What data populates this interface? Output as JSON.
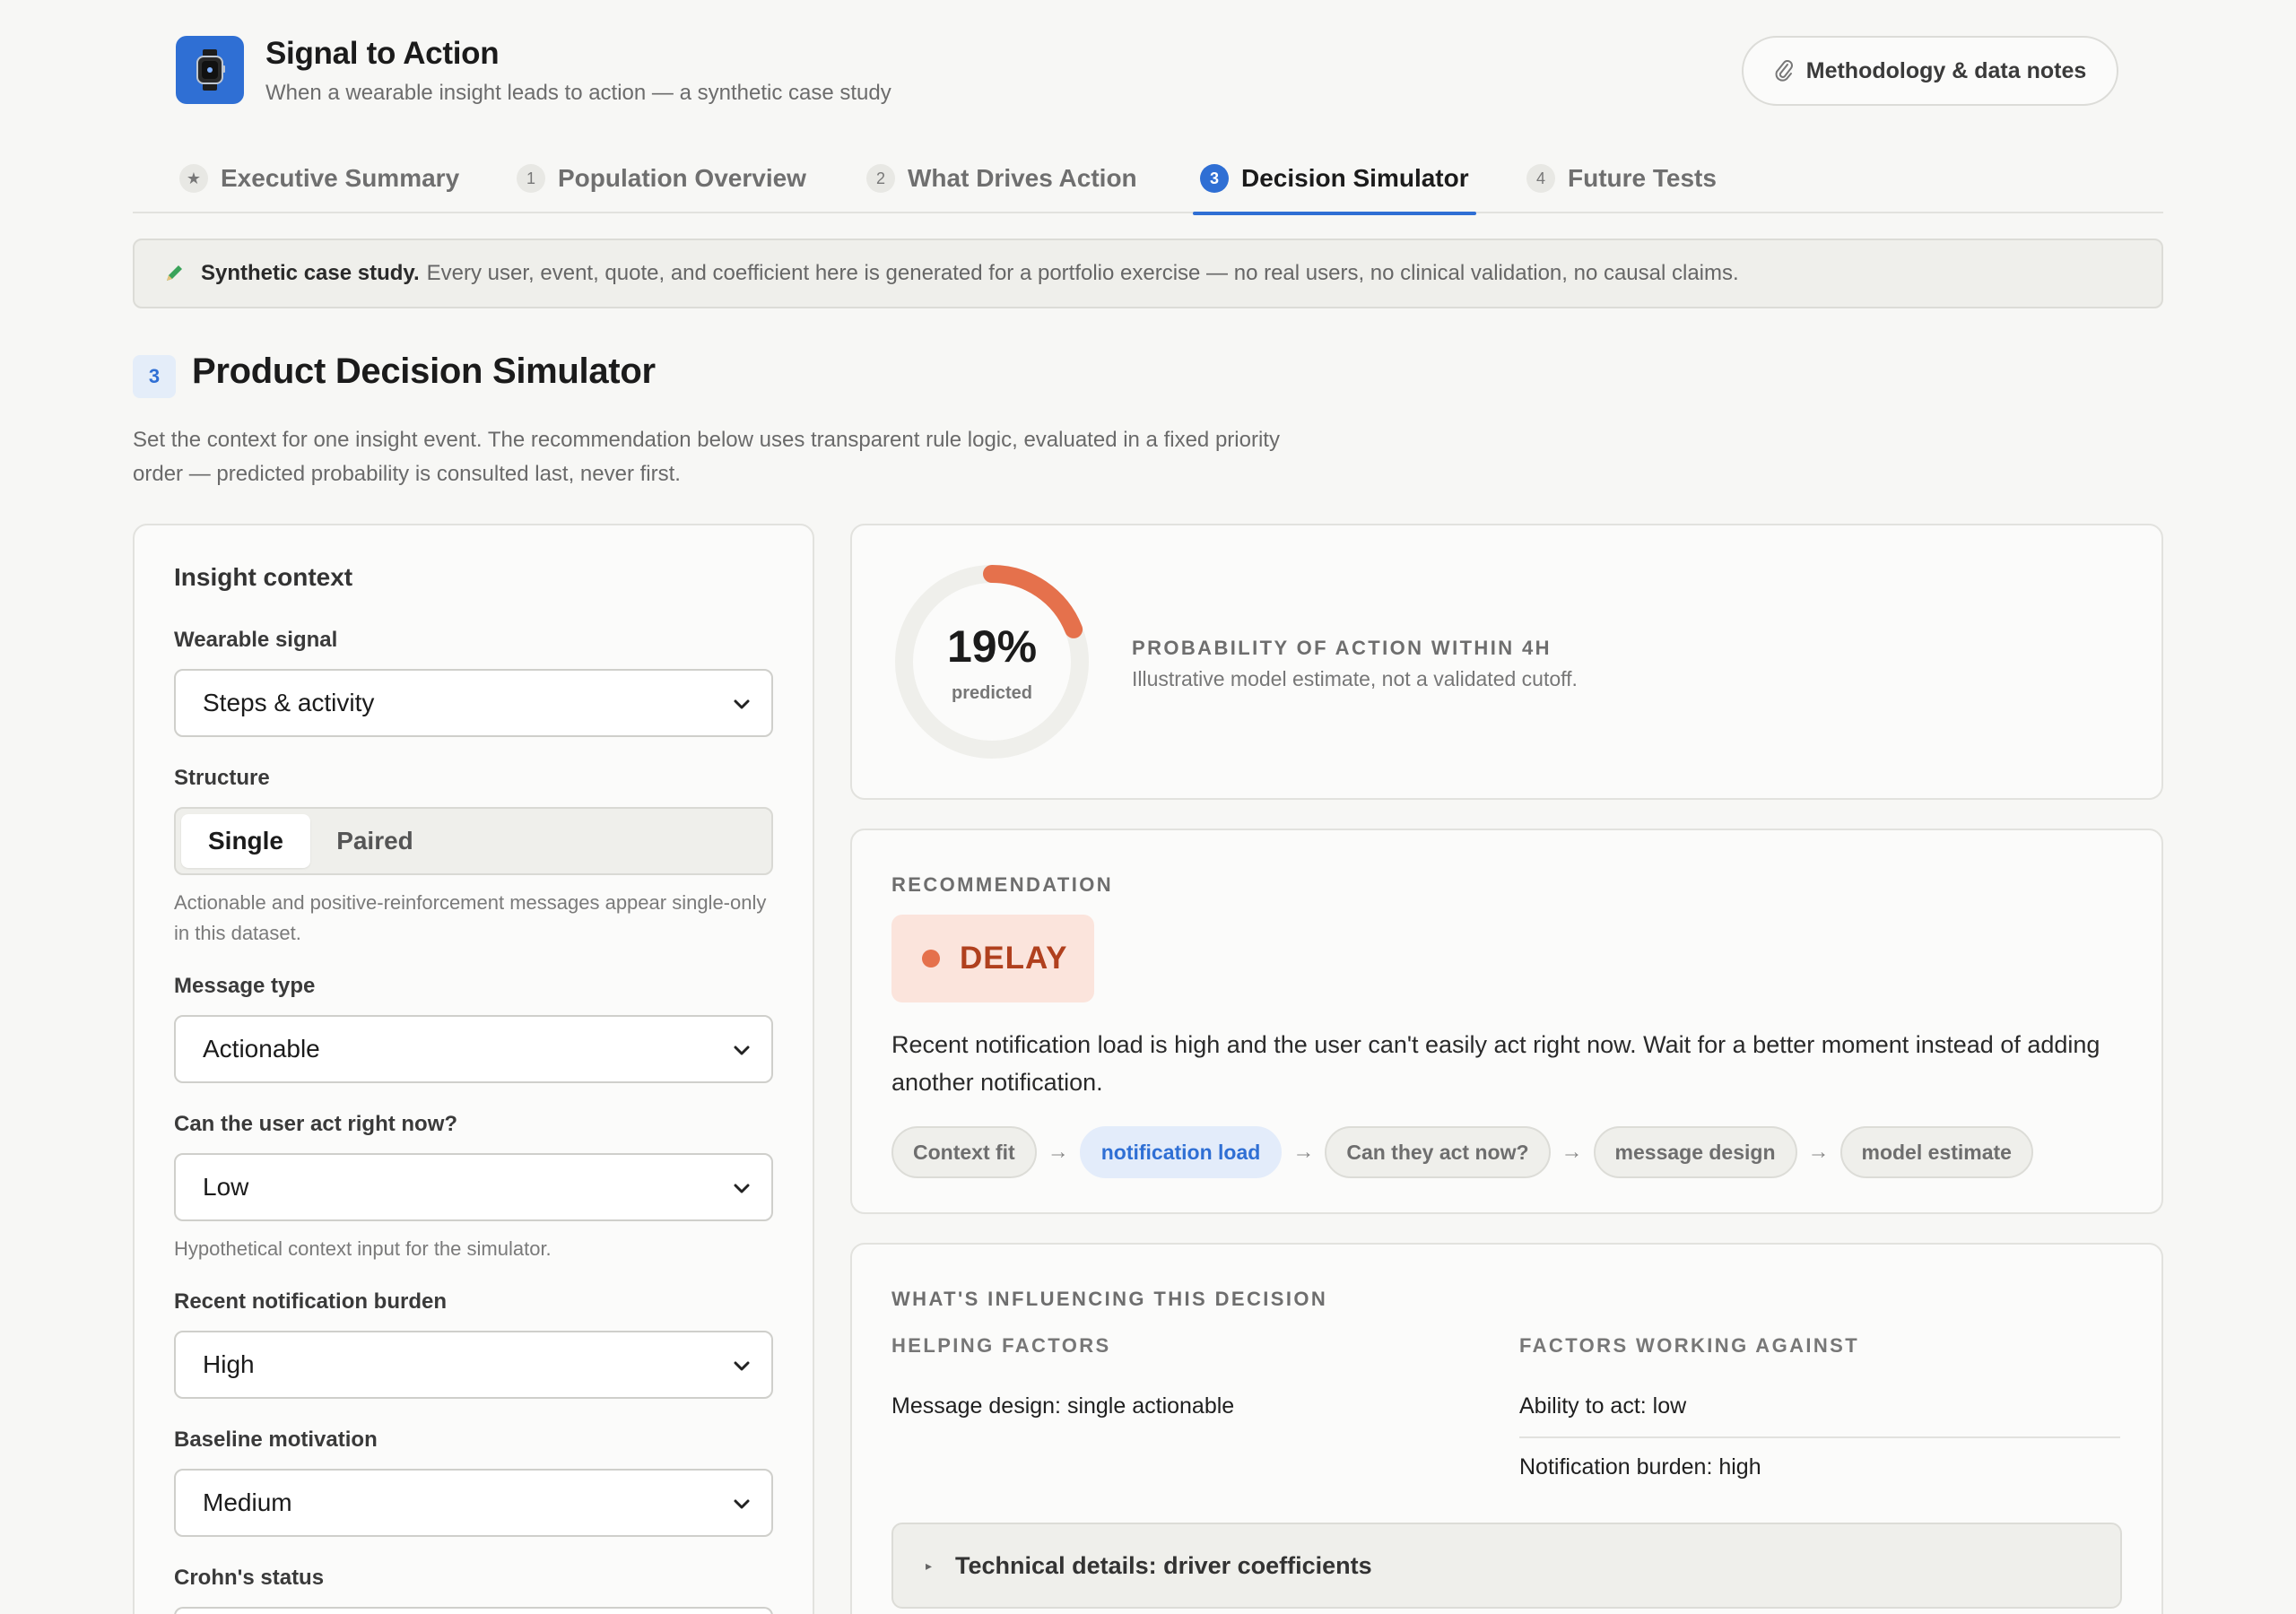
{
  "app": {
    "title": "Signal to Action",
    "subtitle": "When a wearable insight leads to action — a synthetic case study",
    "methodology_label": "Methodology & data notes"
  },
  "tabs": [
    {
      "num": "★",
      "label": "Executive Summary"
    },
    {
      "num": "1",
      "label": "Population Overview"
    },
    {
      "num": "2",
      "label": "What Drives Action"
    },
    {
      "num": "3",
      "label": "Decision Simulator",
      "active": true
    },
    {
      "num": "4",
      "label": "Future Tests"
    }
  ],
  "banner": {
    "strong": "Synthetic case study.",
    "text": "Every user, event, quote, and coefficient here is generated for a portfolio exercise — no real users, no clinical validation, no causal claims."
  },
  "section": {
    "badge": "3",
    "title": "Product Decision Simulator",
    "desc": "Set the context for one insight event. The recommendation below uses transparent rule logic, evaluated in a fixed priority order — predicted probability is consulted last, never first."
  },
  "form": {
    "heading": "Insight context",
    "signal_label": "Wearable signal",
    "signal_value": "Steps & activity",
    "structure_label": "Structure",
    "structure_options": [
      "Single",
      "Paired"
    ],
    "structure_selected": "Single",
    "structure_hint": "Actionable and positive-reinforcement messages appear single-only in this dataset.",
    "message_label": "Message type",
    "message_value": "Actionable",
    "act_label": "Can the user act right now?",
    "act_value": "Low",
    "act_hint": "Hypothetical context input for the simulator.",
    "burden_label": "Recent notification burden",
    "burden_value": "High",
    "motivation_label": "Baseline motivation",
    "motivation_value": "Medium",
    "crohns_label": "Crohn's status"
  },
  "probability": {
    "value": "19%",
    "value_fraction": 0.19,
    "label": "predicted",
    "title": "PROBABILITY OF ACTION WITHIN 4H",
    "subtitle": "Illustrative model estimate, not a validated cutoff."
  },
  "recommendation": {
    "eyebrow": "RECOMMENDATION",
    "decision": "DELAY",
    "text": "Recent notification load is high and the user can't easily act right now. Wait for a better moment instead of adding another notification.",
    "flow": [
      "Context fit",
      "notification load",
      "Can they act now?",
      "message design",
      "model estimate"
    ],
    "flow_highlight": "notification load",
    "flow_arrow": "→"
  },
  "influence": {
    "eyebrow": "WHAT'S INFLUENCING THIS DECISION",
    "helping_title": "HELPING FACTORS",
    "helping": [
      "Message design: single actionable"
    ],
    "against_title": "FACTORS WORKING AGAINST",
    "against": [
      "Ability to act: low",
      "Notification burden: high"
    ],
    "technical_label": "Technical details: driver coefficients"
  },
  "colors": {
    "accent": "#2f6fd4",
    "delay_bg": "#fbe4dc",
    "delay_text": "#b0401e",
    "donut_arc": "#e5714c",
    "donut_track": "#efefeb"
  },
  "icons": {
    "logo": "smartwatch-icon",
    "methodology": "paperclip-icon",
    "banner": "pencil-icon"
  }
}
